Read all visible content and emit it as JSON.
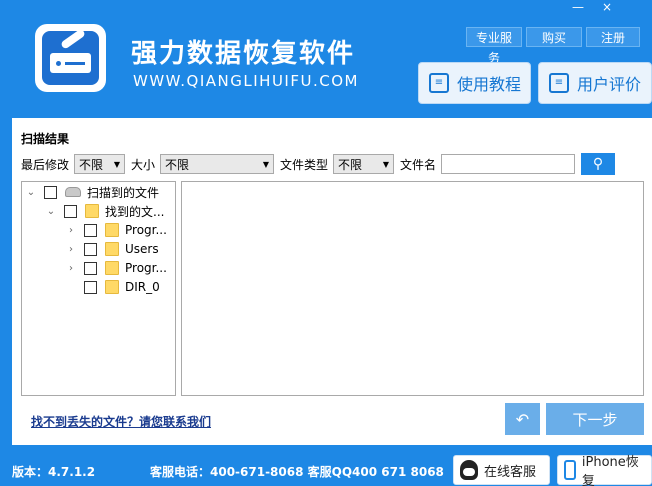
{
  "header": {
    "title": "强力数据恢复软件",
    "url": "WWW.QIANGLIHUIFU.COM",
    "top_links": [
      "专业服务",
      "购买",
      "注册"
    ],
    "window_controls": {
      "minimize": "—",
      "close": "×"
    },
    "guide_label": "使用教程",
    "review_label": "用户评价"
  },
  "filter": {
    "section_title": "扫描结果",
    "modified_label": "最后修改",
    "modified_value": "不限",
    "size_label": "大小",
    "size_value": "不限",
    "type_label": "文件类型",
    "type_value": "不限",
    "name_label": "文件名",
    "name_value": ""
  },
  "tree": {
    "root_label": "扫描到的文件",
    "found_label": "找到的文...",
    "items": [
      "Progr...",
      "Users",
      "Progr...",
      "DIR_0"
    ]
  },
  "actions": {
    "help_link": "找不到丢失的文件？请您联系我们",
    "back_symbol": "↶",
    "next_label": "下一步"
  },
  "footer": {
    "version": "版本：4.7.1.2",
    "phone": "客服电话：400-671-8068 客服QQ400 671 8068",
    "service_label": "在线客服",
    "iphone_label": "iPhone恢复"
  },
  "colors": {
    "brand_blue": "#1e88e5",
    "button_light_blue": "#6aaee9",
    "link_navy": "#1a3b8f"
  }
}
